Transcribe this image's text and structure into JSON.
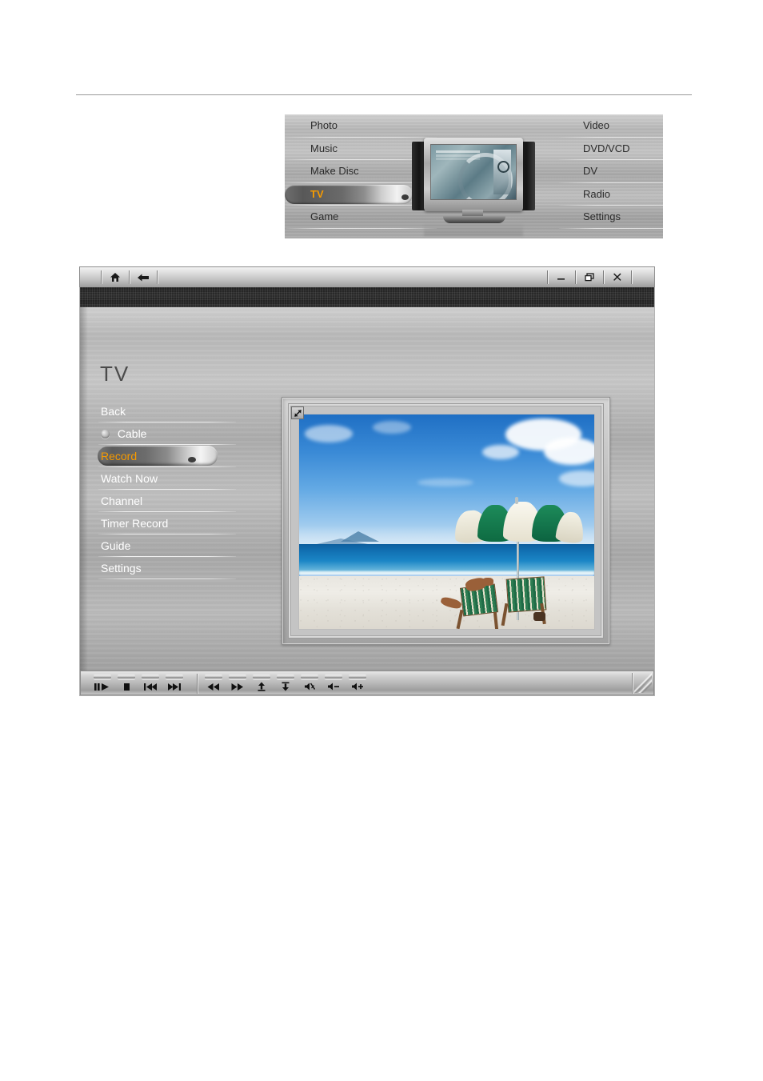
{
  "main_menu": {
    "left_items": [
      {
        "label": "Photo",
        "selected": false
      },
      {
        "label": "Music",
        "selected": false
      },
      {
        "label": "Make Disc",
        "selected": false
      },
      {
        "label": "TV",
        "selected": true
      },
      {
        "label": "Game",
        "selected": false
      }
    ],
    "right_items": [
      {
        "label": "Video",
        "selected": false
      },
      {
        "label": "DVD/VCD",
        "selected": false
      },
      {
        "label": "DV",
        "selected": false
      },
      {
        "label": "Radio",
        "selected": false
      },
      {
        "label": "Settings",
        "selected": false
      }
    ],
    "illustration": "crt-television-icon"
  },
  "window": {
    "title_bar": {
      "home_icon": "home-icon",
      "back_icon": "back-arrow-icon",
      "minimize_icon": "minimize-icon",
      "restore_icon": "restore-icon",
      "close_icon": "close-icon"
    },
    "page_title": "TV",
    "sidebar": [
      {
        "label": "Back",
        "type": "link",
        "selected": false
      },
      {
        "label": "Cable",
        "type": "radio",
        "selected": false
      },
      {
        "label": "Record",
        "type": "link",
        "selected": true
      },
      {
        "label": "Watch Now",
        "type": "link",
        "selected": false
      },
      {
        "label": "Channel",
        "type": "link",
        "selected": false
      },
      {
        "label": "Timer Record",
        "type": "link",
        "selected": false
      },
      {
        "label": "Guide",
        "type": "link",
        "selected": false
      },
      {
        "label": "Settings",
        "type": "link",
        "selected": false
      }
    ],
    "preview": {
      "expand_icon": "expand-diagonal-icon",
      "content_description": "beach scene with green and white umbrella, deck chairs, sea and sky"
    },
    "toolbar": {
      "transport_group": [
        {
          "name": "play-pause-button",
          "icon": "play-pause-icon"
        },
        {
          "name": "stop-button",
          "icon": "stop-icon"
        },
        {
          "name": "previous-button",
          "icon": "skip-previous-icon"
        },
        {
          "name": "next-button",
          "icon": "skip-next-icon"
        }
      ],
      "media_group": [
        {
          "name": "rewind-button",
          "icon": "rewind-icon"
        },
        {
          "name": "fast-forward-button",
          "icon": "fast-forward-icon"
        },
        {
          "name": "channel-up-button",
          "icon": "channel-up-icon"
        },
        {
          "name": "channel-down-button",
          "icon": "channel-down-icon"
        },
        {
          "name": "mute-button",
          "icon": "mute-icon"
        },
        {
          "name": "volume-down-button",
          "icon": "volume-down-icon"
        },
        {
          "name": "volume-up-button",
          "icon": "volume-up-icon"
        }
      ]
    }
  },
  "colors": {
    "accent": "#f59a00",
    "text_light": "#ffffff",
    "text_dark": "#2b2b2b",
    "title": "#4b4b4b"
  }
}
